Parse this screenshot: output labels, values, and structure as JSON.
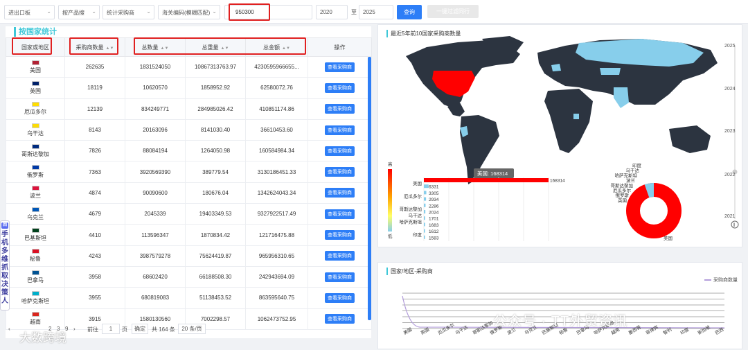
{
  "filters": {
    "trade": "进出口板",
    "search_by": "按产品搜",
    "stat": "统计采购商",
    "hs_mode": "海关编码(模糊匹配)",
    "hs_code": "950300",
    "year_from": "2020",
    "year_to": "2025",
    "to_label": "至",
    "query_btn": "查询",
    "filter_btn": "一键过滤同行"
  },
  "left": {
    "title": "按国家统计",
    "columns": [
      "国家或地区",
      "采购商数量",
      "总数量",
      "总重量",
      "总金额",
      "操作"
    ],
    "action_label": "查看采购商",
    "rows": [
      {
        "country": "美国",
        "buyers": "262635",
        "qty": "1831524050",
        "weight": "10867313763.97",
        "amount": "4230595966655...",
        "flag": "#b22234"
      },
      {
        "country": "英国",
        "buyers": "18119",
        "qty": "10620570",
        "weight": "1858952.92",
        "amount": "62580072.76",
        "flag": "#012169"
      },
      {
        "country": "厄瓜多尔",
        "buyers": "12139",
        "qty": "834249771",
        "weight": "284985026.42",
        "amount": "410851174.86",
        "flag": "#ffdd00"
      },
      {
        "country": "乌干达",
        "buyers": "8143",
        "qty": "20163096",
        "weight": "8141030.40",
        "amount": "36610453.60",
        "flag": "#fcdc04"
      },
      {
        "country": "哥斯达黎加",
        "buyers": "7826",
        "qty": "88084194",
        "weight": "1264050.98",
        "amount": "160584984.34",
        "flag": "#002b7f"
      },
      {
        "country": "俄罗斯",
        "buyers": "7363",
        "qty": "3920569390",
        "weight": "389779.54",
        "amount": "3130186451.33",
        "flag": "#0039a6"
      },
      {
        "country": "波兰",
        "buyers": "4874",
        "qty": "90090600",
        "weight": "180676.04",
        "amount": "1342624043.34",
        "flag": "#dc143c"
      },
      {
        "country": "乌克兰",
        "buyers": "4679",
        "qty": "2045339",
        "weight": "19403349.53",
        "amount": "9327922517.49",
        "flag": "#0057b7"
      },
      {
        "country": "巴基斯坦",
        "buyers": "4410",
        "qty": "113596347",
        "weight": "1870834.42",
        "amount": "121716475.88",
        "flag": "#01411c"
      },
      {
        "country": "秘鲁",
        "buyers": "4243",
        "qty": "3987579278",
        "weight": "75624419.87",
        "amount": "965956310.65",
        "flag": "#d91023"
      },
      {
        "country": "巴拿马",
        "buyers": "3958",
        "qty": "68602420",
        "weight": "66188508.30",
        "amount": "242943694.09",
        "flag": "#005293"
      },
      {
        "country": "哈萨克斯坦",
        "buyers": "3955",
        "qty": "680819083",
        "weight": "51138453.52",
        "amount": "863595640.75",
        "flag": "#00afca"
      },
      {
        "country": "越南",
        "buyers": "3915",
        "qty": "1580130560",
        "weight": "7002298.57",
        "amount": "1062473752.95",
        "flag": "#da251d"
      }
    ],
    "pager": {
      "page_nums": [
        "2",
        "3",
        "9"
      ],
      "goto": "前往",
      "page_value": "1",
      "page_unit": "页",
      "confirm": "确定",
      "total": "共 164 条",
      "per_page": "20 条/页"
    }
  },
  "map_panel": {
    "title": "最近5年前10国家采购商数量",
    "tooltip": "美国: 168314",
    "legend_high": "高",
    "legend_low": "低",
    "timeline": [
      "2025",
      "2024",
      "2023",
      "2022",
      "2021"
    ],
    "pause_icon": "pause-icon",
    "pie_labels": [
      "印度",
      "乌干达",
      "哈萨克斯坦",
      "波兰",
      "哥斯达黎加",
      "厄瓜多尔",
      "俄罗斯",
      "英国"
    ],
    "pie_main_label": "美国"
  },
  "chart_data": {
    "type": "bar",
    "categories": [
      "美国",
      "英国",
      "厄瓜多尔",
      "俄罗斯",
      "哥斯达黎加",
      "乌干达",
      "哈萨克斯坦",
      "印度"
    ],
    "values": [
      168314,
      6331,
      3305,
      2934,
      2286,
      2024,
      1701,
      1683,
      1612,
      1583
    ],
    "value_labels": [
      "168314",
      "6331",
      "3305",
      "2934",
      "2286",
      "2024",
      "1701",
      "1683",
      "1612",
      "1583"
    ]
  },
  "line_panel": {
    "title": "国家/地区-采购商",
    "legend": "采购商数量",
    "x_labels": [
      "美国",
      "英国",
      "厄瓜多尔",
      "乌干达",
      "哥斯达黎加",
      "俄罗斯",
      "波兰",
      "乌克兰",
      "巴基斯坦",
      "秘鲁",
      "巴拿马",
      "哈萨克斯坦",
      "越南",
      "墨西哥",
      "菲律宾",
      "智利",
      "印度",
      "新加坡",
      "巴西"
    ]
  },
  "overlay": {
    "side_badge": "回",
    "side_text": "手机多维抓取决策人",
    "watermark": "公众号 · TT外贸资讯",
    "logo": "大数跨境"
  },
  "colors": {
    "primary": "#2d7ef7",
    "accent": "#3fc8d8",
    "highlight": "#e02020",
    "map_land": "#2c3440",
    "map_light": "#87ceeb",
    "map_max": "#ff0000"
  }
}
